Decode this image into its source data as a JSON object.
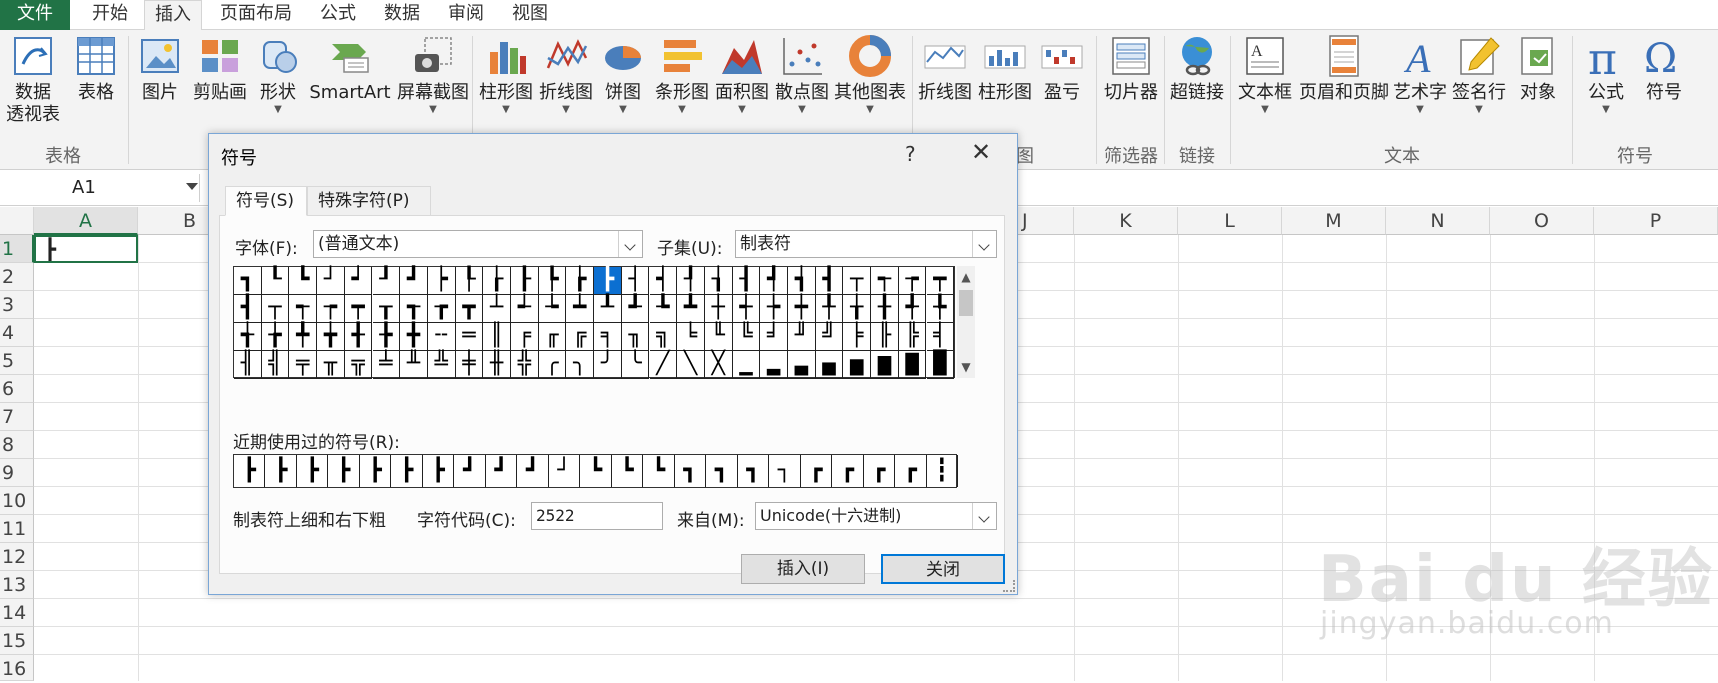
{
  "ribbon_tabs": [
    "文件",
    "开始",
    "插入",
    "页面布局",
    "公式",
    "数据",
    "审阅",
    "视图"
  ],
  "ribbon": {
    "buttons": {
      "pivot_line1": "数据",
      "pivot_line2": "透视表",
      "table": "表格",
      "picture": "图片",
      "clipart": "剪贴画",
      "shapes": "形状",
      "smartart": "SmartArt",
      "screenshot": "屏幕截图",
      "column_chart": "柱形图",
      "line_chart": "折线图",
      "pie_chart": "饼图",
      "bar_chart": "条形图",
      "area_chart": "面积图",
      "scatter_chart": "散点图",
      "other_charts": "其他图表",
      "spark_line": "折线图",
      "spark_column": "柱形图",
      "spark_winloss": "盈亏",
      "slicer": "切片器",
      "hyperlink": "超链接",
      "textbox": "文本框",
      "header_footer": "页眉和页脚",
      "wordart": "艺术字",
      "signature": "签名行",
      "object": "对象",
      "equation": "公式",
      "symbol": "符号"
    },
    "groups": {
      "tables": "表格",
      "charts_tail": "图",
      "filter": "筛选器",
      "links": "链接",
      "text": "文本",
      "symbols": "符号"
    }
  },
  "formula_bar": {
    "name_box": "A1"
  },
  "sheet": {
    "columns_left": [
      "A",
      "B"
    ],
    "columns_right": [
      "J",
      "K",
      "L",
      "M",
      "N",
      "O",
      "P"
    ],
    "rows": [
      "1",
      "2",
      "3",
      "4",
      "5",
      "6",
      "7",
      "8",
      "9",
      "10",
      "11",
      "12",
      "13",
      "14",
      "15",
      "16"
    ],
    "cell_a1": "┣"
  },
  "watermark": {
    "main": "Bai du 经验",
    "sub": "jingyan.baidu.com"
  },
  "dialog": {
    "title": "符号",
    "help": "?",
    "close": "✕",
    "tab_symbols": "符号(S)",
    "tab_special": "特殊字符(P)",
    "font_label": "字体(F):",
    "font_value": "(普通文本)",
    "subset_label": "子集(U):",
    "subset_value": "制表符",
    "symbol_rows": [
      [
        "┓",
        "┖",
        "┗",
        "┘",
        "┙",
        "┚",
        "┛",
        "┝",
        "┞",
        "┟",
        "┠",
        "┡",
        "┢",
        "┣",
        "┤",
        "┥",
        "┦",
        "┧",
        "┨",
        "┩",
        "┪",
        "┫",
        "┬",
        "┭",
        "┮",
        "┯"
      ],
      [
        "┫",
        "┬",
        "┭",
        "┮",
        "┯",
        "┰",
        "┱",
        "┲",
        "┳",
        "┴",
        "┵",
        "┶",
        "┷",
        "┸",
        "┹",
        "┺",
        "┻",
        "┼",
        "┽",
        "┾",
        "┿",
        "╀",
        "╁",
        "╂",
        "╃",
        "╄"
      ],
      [
        "╅",
        "╆",
        "╇",
        "╈",
        "╉",
        "╊",
        "╋",
        "╌",
        "═",
        "║",
        "╒",
        "╓",
        "╔",
        "╕",
        "╖",
        "╗",
        "╘",
        "╙",
        "╚",
        "╛",
        "╜",
        "╝",
        "╞",
        "╟",
        "╠",
        "╡"
      ],
      [
        "╢",
        "╣",
        "╤",
        "╥",
        "╦",
        "╧",
        "╨",
        "╩",
        "╪",
        "╫",
        "╬",
        "╭",
        "╮",
        "╯",
        "╰",
        "╱",
        "╲",
        "╳",
        "▁",
        "▂",
        "▃",
        "▄",
        "▅",
        "▆",
        "▇",
        "█"
      ]
    ],
    "recent_label": "近期使用过的符号(R):",
    "recent_symbols": [
      "┣",
      "┣",
      "┣",
      "┣",
      "┣",
      "┣",
      "┣",
      "┛",
      "┛",
      "┛",
      "┘",
      "┗",
      "┗",
      "┗",
      "┓",
      "┓",
      "┓",
      "┐",
      "┏",
      "┏",
      "┏",
      "┏",
      "┇"
    ],
    "char_name": "制表符上细和右下粗",
    "char_code_label": "字符代码(C):",
    "char_code_value": "2522",
    "from_label": "来自(M):",
    "from_value": "Unicode(十六进制)",
    "insert_button": "插入(I)",
    "close_button": "关闭"
  }
}
